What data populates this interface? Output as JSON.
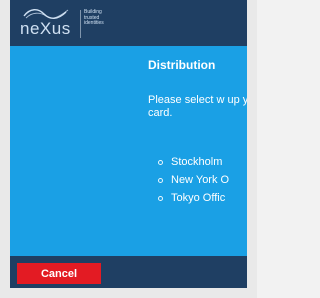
{
  "header": {
    "logo_text": "neXus",
    "tagline_lines": [
      "Building",
      "trusted",
      "identities"
    ]
  },
  "content": {
    "title": "Distribution",
    "prompt": "Please select w up your card.",
    "options": [
      {
        "label": "Stockholm"
      },
      {
        "label": "New York O"
      },
      {
        "label": "Tokyo Offic"
      }
    ]
  },
  "footer": {
    "cancel_label": "Cancel"
  },
  "colors": {
    "header_bg": "#1f3f63",
    "content_bg": "#1aa0e5",
    "cancel_bg": "#e31b23"
  }
}
